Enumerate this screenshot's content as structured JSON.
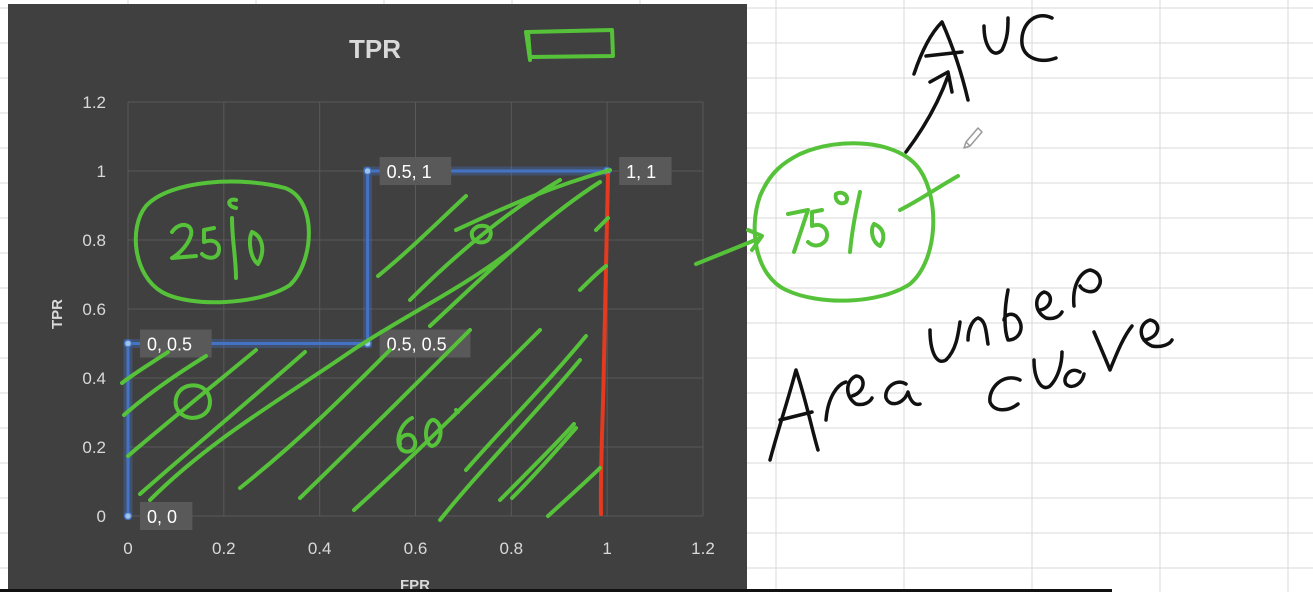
{
  "chart_data": {
    "type": "scatter",
    "title": "TPR",
    "xlabel": "FPR",
    "ylabel": "TPR",
    "xlim": [
      0,
      1.2
    ],
    "ylim": [
      0,
      1.2
    ],
    "x_ticks": [
      "0",
      "0.2",
      "0.4",
      "0.6",
      "0.8",
      "1",
      "1.2"
    ],
    "y_ticks": [
      "0",
      "0.2",
      "0.4",
      "0.6",
      "0.8",
      "1",
      "1.2"
    ],
    "grid": true,
    "series": [
      {
        "points": [
          {
            "x": 0,
            "y": 0,
            "label": "0, 0"
          },
          {
            "x": 0,
            "y": 0.5,
            "label": "0, 0.5"
          },
          {
            "x": 0.5,
            "y": 0.5,
            "label": "0.5, 0.5"
          },
          {
            "x": 0.5,
            "y": 1,
            "label": "0.5, 1"
          },
          {
            "x": 1,
            "y": 1,
            "label": "1, 1"
          }
        ]
      }
    ],
    "colors": {
      "background": "#404040",
      "line": "#4472c4",
      "text": "#d9d9d9",
      "grid": "#595959",
      "label_box": "#595959"
    }
  },
  "annotations": {
    "handwritten_texts": [
      "25%",
      "0",
      "60",
      "75%",
      "AUC",
      "Area under",
      "curve"
    ],
    "ink_colors": {
      "green": "#56c23a",
      "red": "#e53a1f",
      "black": "#111111"
    }
  }
}
